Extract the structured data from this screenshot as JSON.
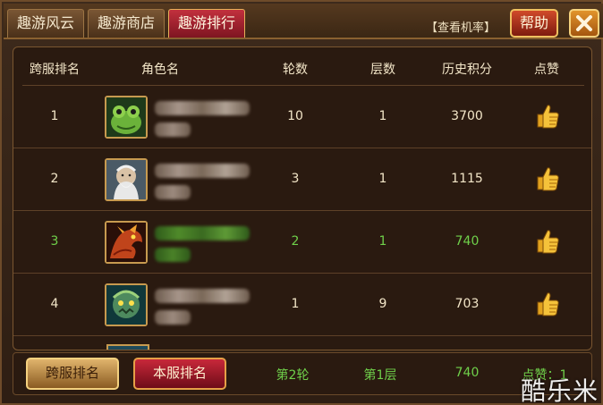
{
  "tabs": [
    {
      "label": "趣游风云",
      "active": false
    },
    {
      "label": "趣游商店",
      "active": false
    },
    {
      "label": "趣游排行",
      "active": true
    }
  ],
  "header_actions": {
    "rate_link": "【查看机率】",
    "help_label": "帮助",
    "close_icon": "close-x-icon"
  },
  "columns": [
    "跨服排名",
    "角色名",
    "轮数",
    "层数",
    "历史积分",
    "点赞"
  ],
  "rows": [
    {
      "rank": "1",
      "rounds": "10",
      "floors": "1",
      "score": "3700",
      "avatar": "frog-avatar-icon",
      "self": false
    },
    {
      "rank": "2",
      "rounds": "3",
      "floors": "1",
      "score": "1115",
      "avatar": "old-sage-avatar-icon",
      "self": false
    },
    {
      "rank": "3",
      "rounds": "2",
      "floors": "1",
      "score": "740",
      "avatar": "dragon-avatar-icon",
      "self": true
    },
    {
      "rank": "4",
      "rounds": "1",
      "floors": "9",
      "score": "703",
      "avatar": "green-beast-avatar-icon",
      "self": false
    }
  ],
  "bottom": {
    "cross_server_label": "跨服排名",
    "local_server_label": "本服排名",
    "my_rounds": "第2轮",
    "my_floors": "第1层",
    "my_score": "740",
    "my_likes": "点赞：1"
  },
  "watermark": "酷乐米",
  "colors": {
    "self_highlight": "#6fd04a",
    "active_tab": "#c2303d",
    "panel_bg": "#2a1a10",
    "gold_border": "#c79a4f"
  }
}
